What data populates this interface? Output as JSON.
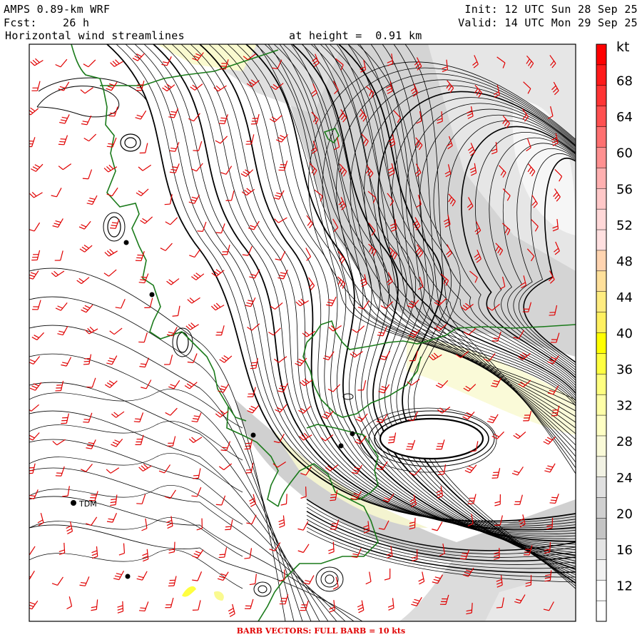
{
  "header": {
    "model": "AMPS 0.89-km WRF",
    "forecast_label": "Fcst:",
    "forecast_hours": "26 h",
    "product": "Horizontal wind streamlines",
    "height_text": "at height =  0.91 km",
    "init": "Init: 12 UTC Sun 28 Sep 25",
    "valid": "Valid: 14 UTC Mon 29 Sep 25"
  },
  "colorbar": {
    "unit": "kt",
    "ticks": [
      "68",
      "64",
      "60",
      "56",
      "52",
      "48",
      "44",
      "40",
      "36",
      "32",
      "28",
      "24",
      "20",
      "16",
      "12"
    ],
    "tick_values": [
      68,
      64,
      60,
      56,
      52,
      48,
      44,
      40,
      36,
      32,
      28,
      24,
      20,
      16,
      12
    ],
    "band_colors": [
      "#ff0000",
      "#ff1a1a",
      "#ff3434",
      "#ff5050",
      "#ff7070",
      "#ff9090",
      "#ffb0b0",
      "#ffc8c8",
      "#ffd8d8",
      "#ffe0e0",
      "#ffd4b0",
      "#ffe09a",
      "#ffec80",
      "#fff060",
      "#ffff00",
      "#ffff40",
      "#ffff80",
      "#ffffa8",
      "#ffffc4",
      "#fafad8",
      "#f2f2e4",
      "#e0e0e0",
      "#d0d0d0",
      "#c4c4c4",
      "#e4e4e4",
      "#f2f2f2",
      "#ffffff",
      "#ffffff"
    ],
    "range_kt": [
      8,
      72
    ]
  },
  "station": {
    "label": "TDM"
  },
  "footer": "BARB VECTORS:  FULL BARB = 10 kts",
  "colors": {
    "coastline": "#1a7a1a",
    "barb": "#e00000",
    "streamline": "#000000",
    "footer": "#e00000"
  }
}
